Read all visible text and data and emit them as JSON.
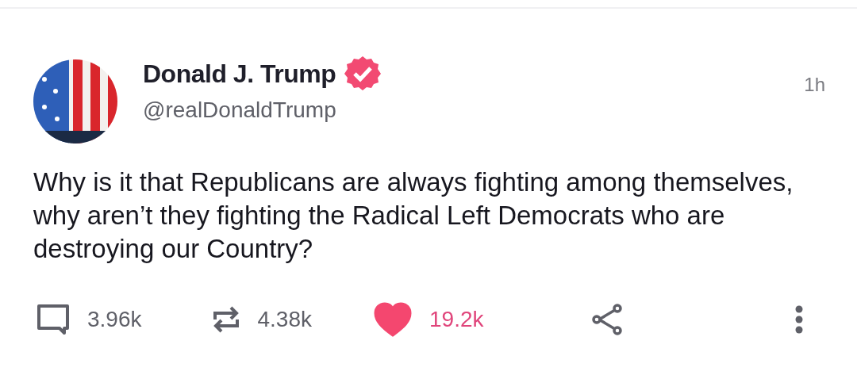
{
  "post": {
    "author": {
      "name": "Donald J. Trump",
      "verified": true,
      "handle": "@realDonaldTrump"
    },
    "time": "1h",
    "text": "Why is it that Republicans are always fighting among themselves, why aren’t they fighting the Radical Left Democrats who are destroying our Country?",
    "actions": [
      {
        "kind": "reply",
        "count": "3.96k"
      },
      {
        "kind": "repost",
        "count": "4.38k"
      },
      {
        "kind": "like",
        "count": "19.2k",
        "selected": true
      },
      {
        "kind": "share"
      },
      {
        "kind": "more"
      }
    ]
  }
}
